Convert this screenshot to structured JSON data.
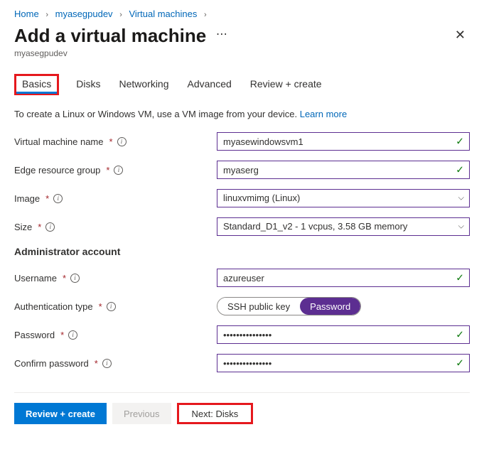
{
  "breadcrumb": {
    "home": "Home",
    "rg": "myasegpudev",
    "vms": "Virtual machines"
  },
  "header": {
    "title": "Add a virtual machine",
    "subtitle": "myasegpudev"
  },
  "tabs": {
    "basics": "Basics",
    "disks": "Disks",
    "networking": "Networking",
    "advanced": "Advanced",
    "review": "Review + create"
  },
  "intro": {
    "text": "To create a Linux or Windows VM, use a VM image from your device. ",
    "link": "Learn more"
  },
  "labels": {
    "vm_name": "Virtual machine name",
    "erg": "Edge resource group",
    "image": "Image",
    "size": "Size",
    "admin_section": "Administrator account",
    "username": "Username",
    "auth_type": "Authentication type",
    "password": "Password",
    "confirm_password": "Confirm password"
  },
  "values": {
    "vm_name": "myasewindowsvm1",
    "erg": "myaserg",
    "image": "linuxvmimg (Linux)",
    "size": "Standard_D1_v2 - 1 vcpus, 3.58 GB memory",
    "username": "azureuser",
    "password": "•••••••••••••••",
    "confirm_password": "•••••••••••••••"
  },
  "auth_options": {
    "ssh": "SSH public key",
    "password": "Password"
  },
  "footer": {
    "review": "Review + create",
    "previous": "Previous",
    "next": "Next: Disks"
  }
}
